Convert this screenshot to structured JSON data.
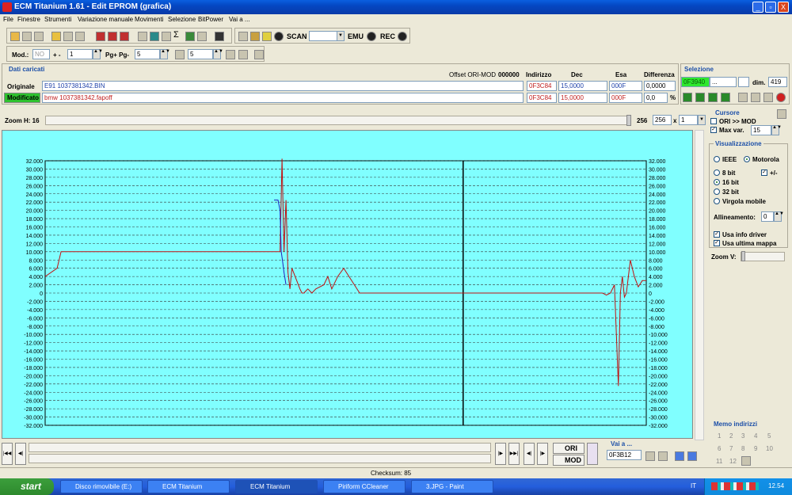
{
  "window": {
    "title": "ECM Titanium 1.61 - Edit EPROM (grafica)",
    "min": "_",
    "max": "▫",
    "close": "X"
  },
  "menu": [
    "File",
    "Finestre",
    "Strumenti",
    "Variazione manuale",
    "Movimenti",
    "Selezione",
    "BitPower",
    "Vai a ..."
  ],
  "toolbar1": {
    "scan": "SCAN",
    "emu": "EMU",
    "rec": "REC"
  },
  "toolbar2": {
    "mod_label": "Mod.:",
    "mod_value": "NO",
    "plusminus": "+ -",
    "plus_value": "1",
    "pg_label": "Pg+ Pg-",
    "pg_value": "5",
    "t_value": "5"
  },
  "dati": {
    "title": "Dati caricati",
    "offset_label": "Offset ORI-MOD",
    "offset_value": "000000",
    "col_indirizzo": "Indirizzo",
    "col_dec": "Dec",
    "col_esa": "Esa",
    "col_diff": "Differenza",
    "orig_label": "Originale",
    "orig_file": "E91 1037381342.BIN",
    "orig_addr": "0F3C84",
    "orig_dec": "15,0000",
    "orig_esa": "000F",
    "orig_diff": "0,0000",
    "mod_label": "Modificato",
    "mod_file": "bmw 1037381342.fapoff",
    "mod_addr": "0F3C84",
    "mod_dec": "15,0000",
    "mod_esa": "000F",
    "mod_diff": "0,0",
    "pct": "%"
  },
  "selezione": {
    "title": "Selezione",
    "start": "0F3940",
    "end": "...",
    "dim_label": "dim.",
    "dim_value": "419"
  },
  "zoom": {
    "label": "Zoom H: 16",
    "v1": "256",
    "v2": "256",
    "x": "x",
    "v3": "1"
  },
  "cursore": {
    "title": "Cursore",
    "ori_mod": "ORI >> MOD",
    "max_var": "Max var.",
    "max_value": "15"
  },
  "visual": {
    "title": "Visualizzazione",
    "ieee": "IEEE",
    "motorola": "Motorola",
    "b8": "8 bit",
    "plusminus": "+/-",
    "b16": "16 bit",
    "b32": "32 bit",
    "virgola": "Virgola mobile",
    "allineamento": "Allineamento:",
    "all_value": "0",
    "usa_driver": "Usa info driver",
    "usa_mappa": "Usa ultima mappa",
    "zoomv": "Zoom V:"
  },
  "memo": {
    "title": "Memo indirizzi",
    "nums": [
      "1",
      "2",
      "3",
      "4",
      "5",
      "6",
      "7",
      "8",
      "9",
      "10",
      "11",
      "12"
    ]
  },
  "bottom": {
    "ori": "ORI",
    "mod": "MOD",
    "vai_label": "Vai a ...",
    "vai_value": "0F3B12",
    "checksum": "Checksum: 85"
  },
  "taskbar": {
    "start": "start",
    "items": [
      "Disco rimovibile (E:)",
      "ECM Titanium",
      "ECM Titanium",
      "Piriform CCleaner",
      "3.JPG - Paint"
    ],
    "lang": "IT",
    "clock": "12.54"
  },
  "chart_data": {
    "type": "line",
    "ylim": [
      -32000,
      32000
    ],
    "yticks": [
      "32.000",
      "30.000",
      "28.000",
      "26.000",
      "24.000",
      "22.000",
      "20.000",
      "18.000",
      "16.000",
      "14.000",
      "12.000",
      "10.000",
      "8.000",
      "6.000",
      "4.000",
      "2.000",
      "0",
      "-2.000",
      "-4.000",
      "-6.000",
      "-8.000",
      "-10.000",
      "-12.000",
      "-14.000",
      "-16.000",
      "-18.000",
      "-20.000",
      "-22.000",
      "-24.000",
      "-26.000",
      "-28.000",
      "-30.000",
      "-32.000"
    ],
    "grid": true,
    "series": [
      {
        "color": "#c01010",
        "x": [
          0,
          3,
          4,
          5,
          58,
          59,
          59.5,
          60,
          60.5,
          61,
          61.5,
          62,
          64,
          64.5,
          65,
          65.5,
          66,
          67,
          68,
          70,
          71,
          72,
          73,
          73.5,
          75,
          79,
          80,
          80.5,
          84,
          88,
          90,
          92,
          94,
          96,
          98,
          100,
          104,
          108,
          112,
          116,
          120,
          124,
          128,
          132,
          136,
          140,
          141,
          142,
          143,
          144,
          144.5,
          145,
          145.5,
          146,
          147,
          148,
          149,
          150,
          151
        ],
        "y": [
          4000,
          6000,
          10000,
          10000,
          10000,
          10000,
          32500,
          10000,
          22500,
          5000,
          1000,
          6000,
          1000,
          0,
          0,
          500,
          1000,
          0,
          1000,
          2000,
          4000,
          1000,
          3000,
          4000,
          6000,
          0,
          0,
          0,
          0,
          0,
          0,
          0,
          0,
          0,
          0,
          0,
          0,
          0,
          0,
          0,
          0,
          0,
          0,
          0,
          0,
          0,
          -500,
          0,
          2000,
          -22500,
          0,
          4000,
          -1000,
          0,
          8000,
          4000,
          1500,
          3000,
          3000
        ]
      },
      {
        "color": "#2020c0",
        "x": [
          57.5,
          58,
          58.5,
          59,
          59.3,
          59.6,
          60,
          60.5
        ],
        "y": [
          22500,
          22500,
          22500,
          20000,
          10000,
          8000,
          5000,
          2000
        ]
      }
    ],
    "xmax": 151,
    "cursor_x": 105
  }
}
